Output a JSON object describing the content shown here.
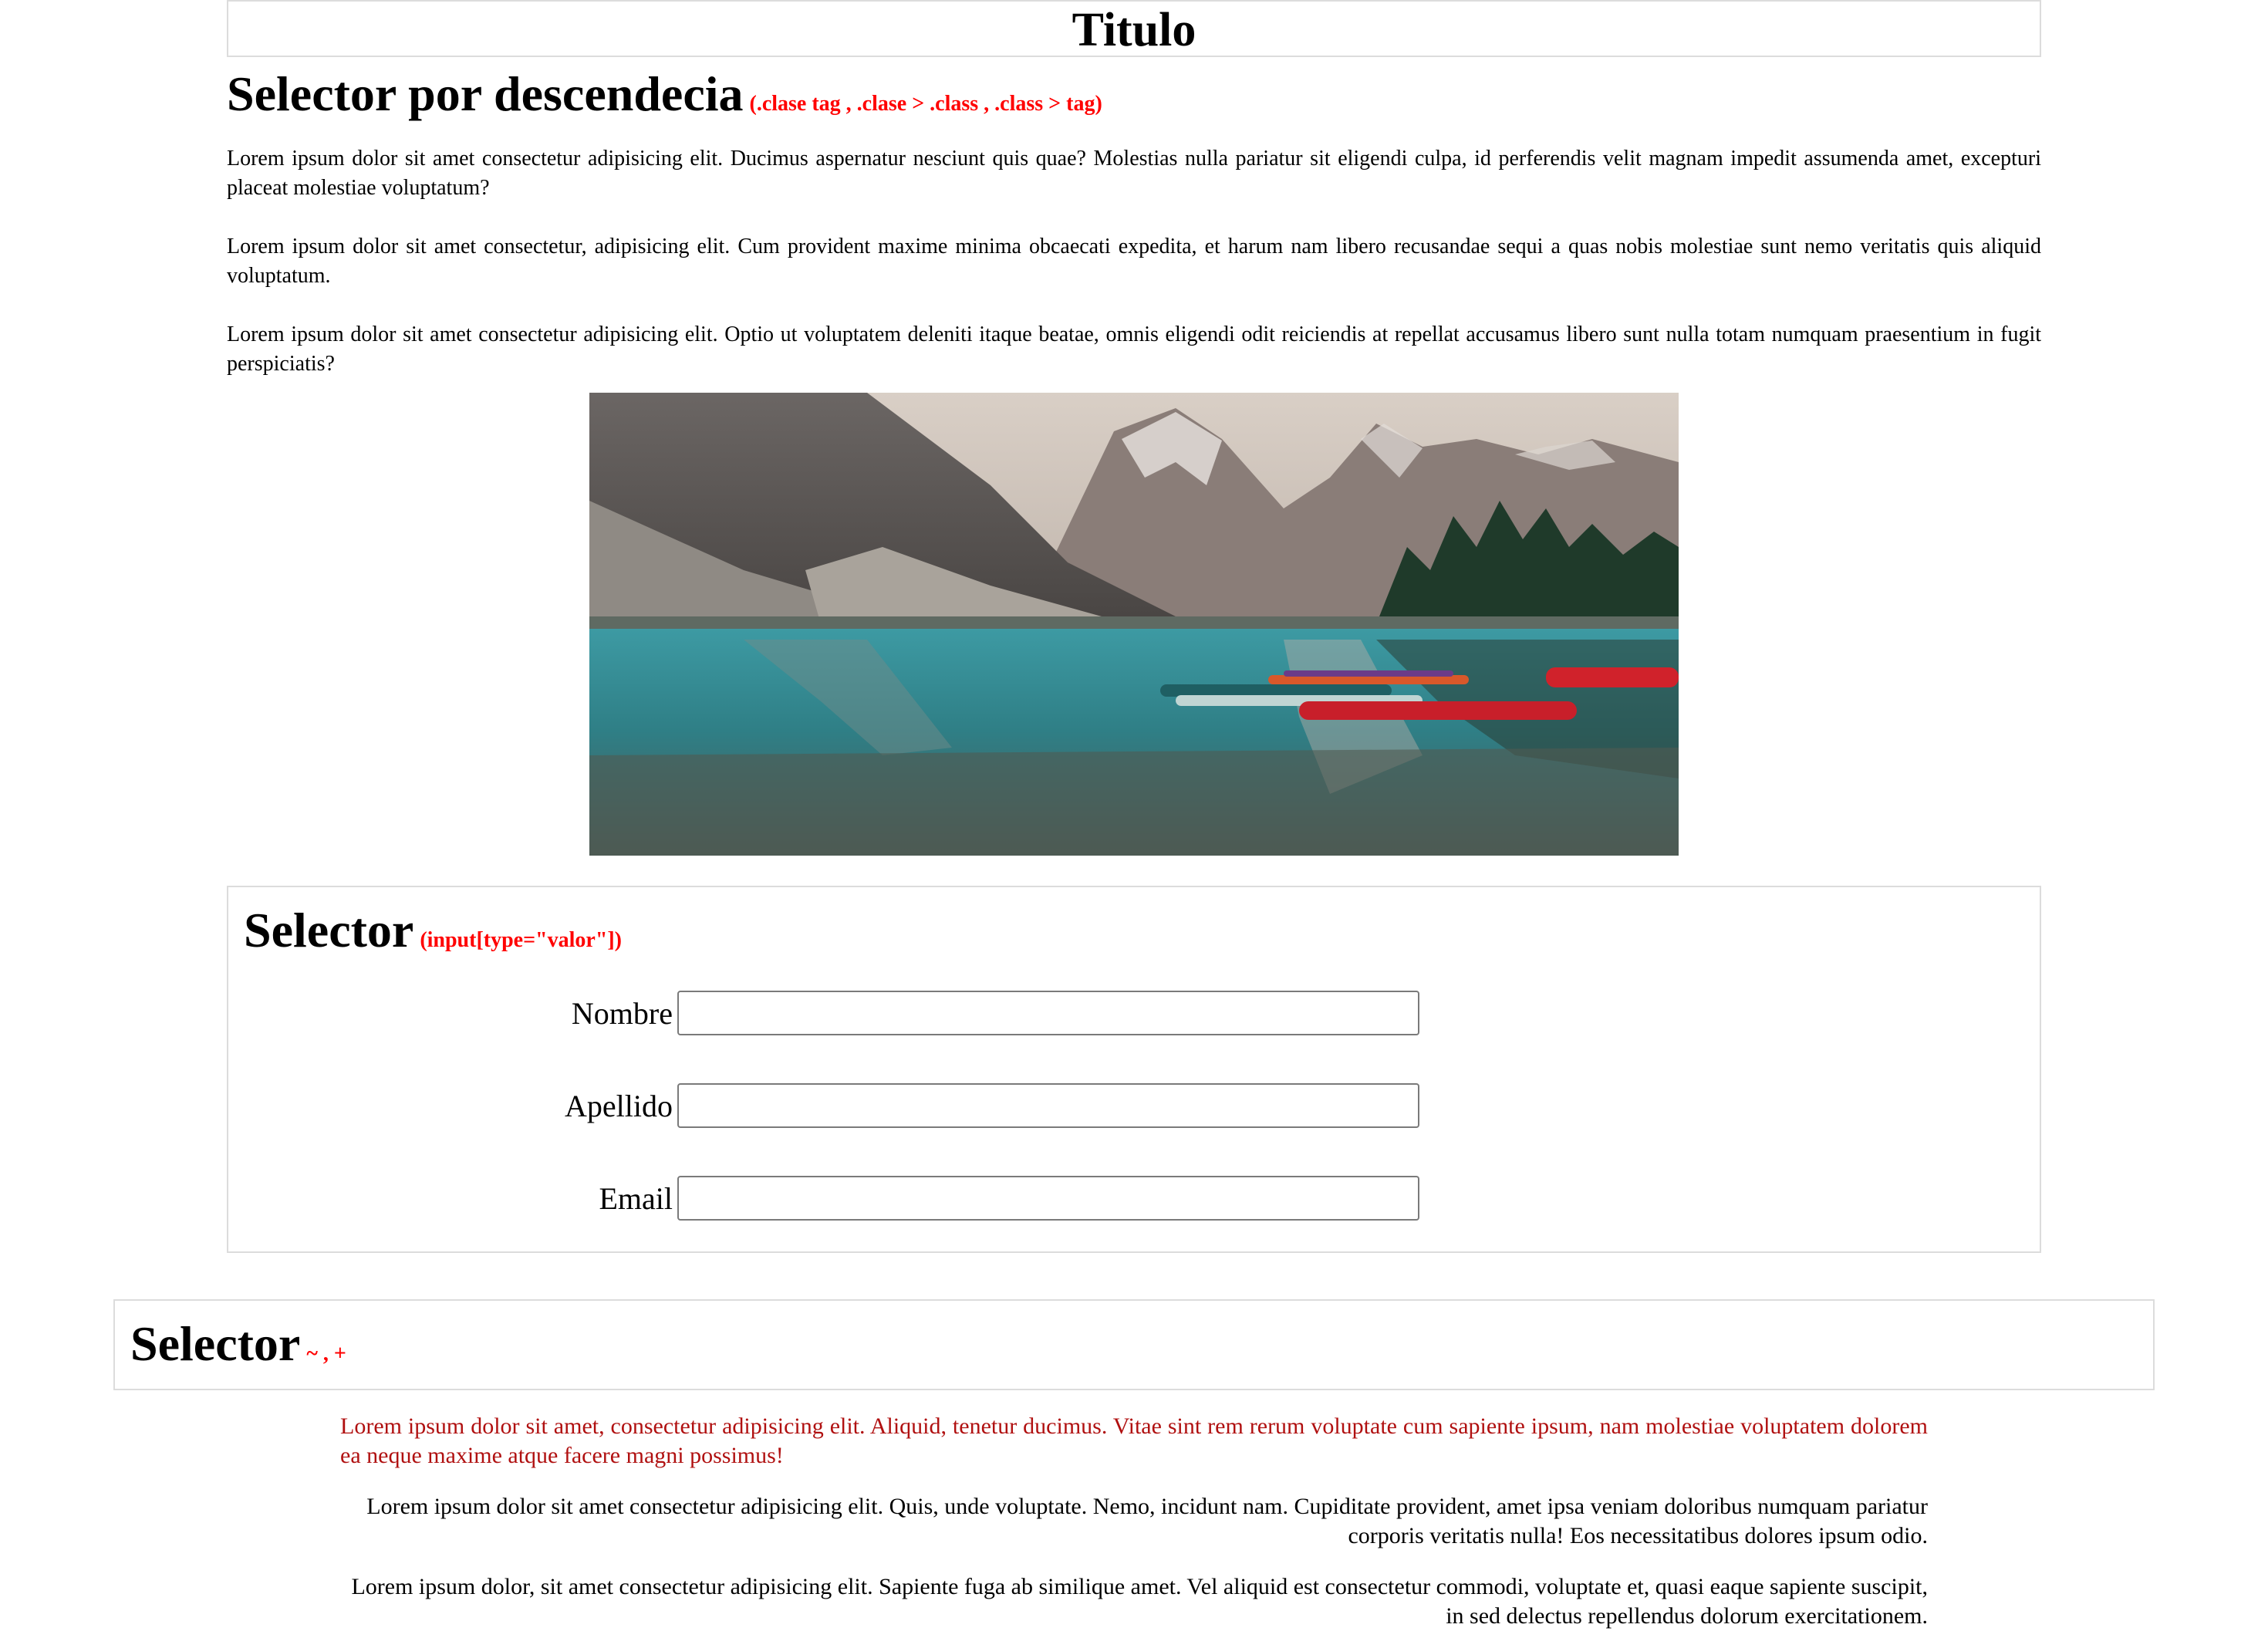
{
  "header": {
    "title": "Titulo"
  },
  "section1": {
    "heading": "Selector por descendecia",
    "note": "(.clase tag , .clase > .class , .class > tag)",
    "paragraphs": [
      "Lorem ipsum dolor sit amet consectetur adipisicing elit. Ducimus aspernatur nesciunt quis quae? Molestias nulla pariatur sit eligendi culpa, id perferendis velit magnam impedit assumenda amet, excepturi placeat molestiae voluptatum?",
      "Lorem ipsum dolor sit amet consectetur, adipisicing elit. Cum provident maxime minima obcaecati expedita, et harum nam libero recusandae sequi a quas nobis molestiae sunt nemo veritatis quis aliquid voluptatum.",
      "Lorem ipsum dolor sit amet consectetur adipisicing elit. Optio ut voluptatem deleniti itaque beatae, omnis eligendi odit reiciendis at repellat accusamus libero sunt nulla totam numquam praesentium in fugit perspiciatis?"
    ]
  },
  "section2": {
    "heading": "Selector",
    "note": "(input[type=\"valor\"])",
    "fields": [
      {
        "label": "Nombre",
        "value": ""
      },
      {
        "label": "Apellido",
        "value": ""
      },
      {
        "label": "Email",
        "value": ""
      }
    ]
  },
  "section3": {
    "heading": "Selector",
    "note": "~ , +",
    "paragraphs": [
      "Lorem ipsum dolor sit amet, consectetur adipisicing elit. Aliquid, tenetur ducimus. Vitae sint rem rerum voluptate cum sapiente ipsum, nam molestiae voluptatem dolorem ea neque maxime atque facere magni possimus!",
      "Lorem ipsum dolor sit amet consectetur adipisicing elit. Quis, unde voluptate. Nemo, incidunt nam. Cupiditate provident, amet ipsa veniam doloribus numquam pariatur corporis veritatis nulla! Eos necessitatibus dolores ipsum odio.",
      "Lorem ipsum dolor, sit amet consectetur adipisicing elit. Sapiente fuga ab similique amet. Vel aliquid est consectetur commodi, voluptate et, quasi eaque sapiente suscipit, in sed delectus repellendus dolorum exercitationem."
    ]
  },
  "colors": {
    "note_red": "#ff0000",
    "sibling_text_red": "#b01010",
    "border": "#dcdcdc"
  }
}
